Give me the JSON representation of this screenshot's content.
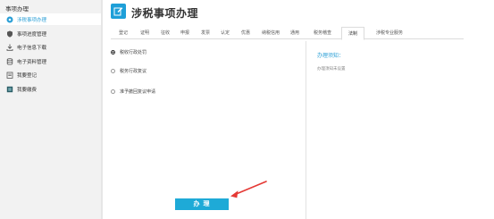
{
  "sidebar": {
    "title": "事项办理",
    "items": [
      {
        "label": "涉税事项办理",
        "icon": "gear-icon",
        "active": true
      },
      {
        "label": "事项进度管理",
        "icon": "shield-icon",
        "active": false
      },
      {
        "label": "电子信息下载",
        "icon": "download-icon",
        "active": false
      },
      {
        "label": "电子资料管理",
        "icon": "database-icon",
        "active": false
      },
      {
        "label": "我要登记",
        "icon": "register-icon",
        "active": false
      },
      {
        "label": "我要缴费",
        "icon": "payment-icon",
        "active": false
      }
    ]
  },
  "header": {
    "title": "涉税事项办理",
    "logo_icon": "edit-icon"
  },
  "tabs": [
    {
      "label": "登记",
      "active": false
    },
    {
      "label": "证明",
      "active": false
    },
    {
      "label": "征收",
      "active": false
    },
    {
      "label": "申报",
      "active": false
    },
    {
      "label": "发票",
      "active": false
    },
    {
      "label": "认定",
      "active": false
    },
    {
      "label": "优惠",
      "active": false
    },
    {
      "label": "纳税信用",
      "active": false
    },
    {
      "label": "通用",
      "active": false
    },
    {
      "label": "税务稽查",
      "active": false
    },
    {
      "label": "法制",
      "active": true
    },
    {
      "label": "涉税专业服务",
      "active": false
    }
  ],
  "options": [
    {
      "label": "税收行政处罚",
      "checked": true
    },
    {
      "label": "税务行政复议",
      "checked": false
    },
    {
      "label": "准予撤回复议申请",
      "checked": false
    }
  ],
  "notice": {
    "title": "办理须知：",
    "text": "办理须知未设置"
  },
  "action_button": {
    "label": "办 理"
  },
  "colors": {
    "accent": "#1eaad7",
    "link": "#2a9fd6",
    "arrow": "#e53935"
  }
}
